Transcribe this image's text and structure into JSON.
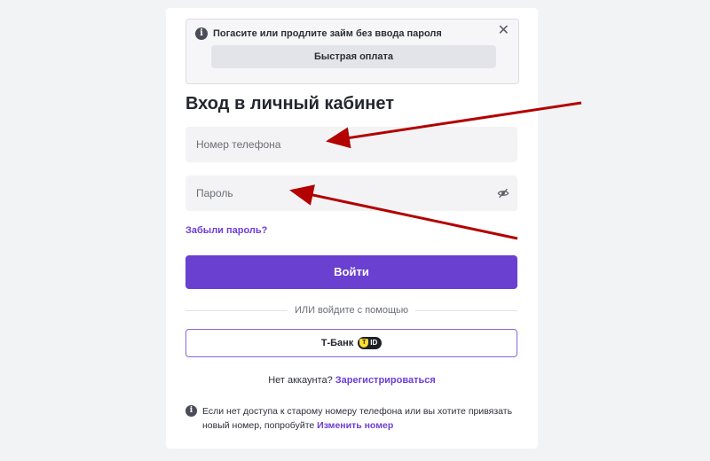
{
  "notice": {
    "text": "Погасите или продлите займ без ввода пароля",
    "close_symbol": "✕",
    "quick_pay_label": "Быстрая оплата"
  },
  "login": {
    "title": "Вход в личный кабинет",
    "phone_placeholder": "Номер телефона",
    "password_placeholder": "Пароль",
    "forgot_label": "Забыли пароль?",
    "submit_label": "Войти",
    "divider_text": "ИЛИ войдите с помощью",
    "tbank_label": "Т-Банк",
    "tbank_badge": "ID"
  },
  "register": {
    "prompt": "Нет аккаунта?",
    "link_label": "Зарегистрироваться"
  },
  "footer": {
    "note_text": "Если нет доступа к старому номеру телефона или вы хотите привязать новый номер, попробуйте",
    "link_label": "Изменить номер"
  },
  "icons": {
    "info": "info-icon",
    "close": "close-icon",
    "eye_off": "eye-off-icon",
    "tbank_shield": "tbank-shield-icon"
  },
  "colors": {
    "accent": "#6a40d1",
    "link": "#6c3fd6",
    "arrow": "#b30000"
  }
}
